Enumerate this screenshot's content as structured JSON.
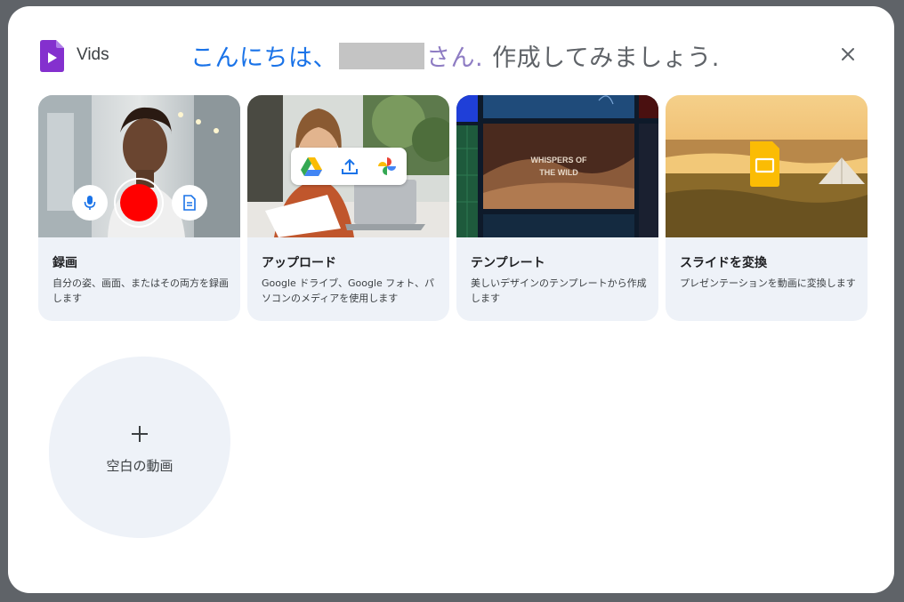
{
  "app": {
    "name": "Vids",
    "logo_icon": "vids-logo-icon",
    "logo_color": "#8430ce"
  },
  "greeting": {
    "prefix": "こんにちは、",
    "suffix": "さん.",
    "cta": "作成してみましょう."
  },
  "colors": {
    "accent_blue": "#1a73e8",
    "accent_purple": "#8e7cc3",
    "record_red": "#ff0000",
    "card_bg": "#eef2f8"
  },
  "cards": [
    {
      "title": "録画",
      "description": "自分の姿、画面、またはその両方を録画します",
      "icons": [
        "microphone-icon",
        "record-icon",
        "document-icon"
      ]
    },
    {
      "title": "アップロード",
      "description": "Google ドライブ、Google フォト、パソコンのメディアを使用します",
      "icons": [
        "google-drive-icon",
        "upload-icon",
        "google-photos-icon"
      ]
    },
    {
      "title": "テンプレート",
      "description": "美しいデザインのテンプレートから作成します",
      "template_text": [
        "WHISPERS OF",
        "THE WILD"
      ]
    },
    {
      "title": "スライドを変換",
      "description": "プレゼンテーションを動画に変換します",
      "icons": [
        "google-slides-icon"
      ]
    }
  ],
  "blank": {
    "label": "空白の動画",
    "icon": "plus-icon"
  },
  "close_icon": "close-icon"
}
